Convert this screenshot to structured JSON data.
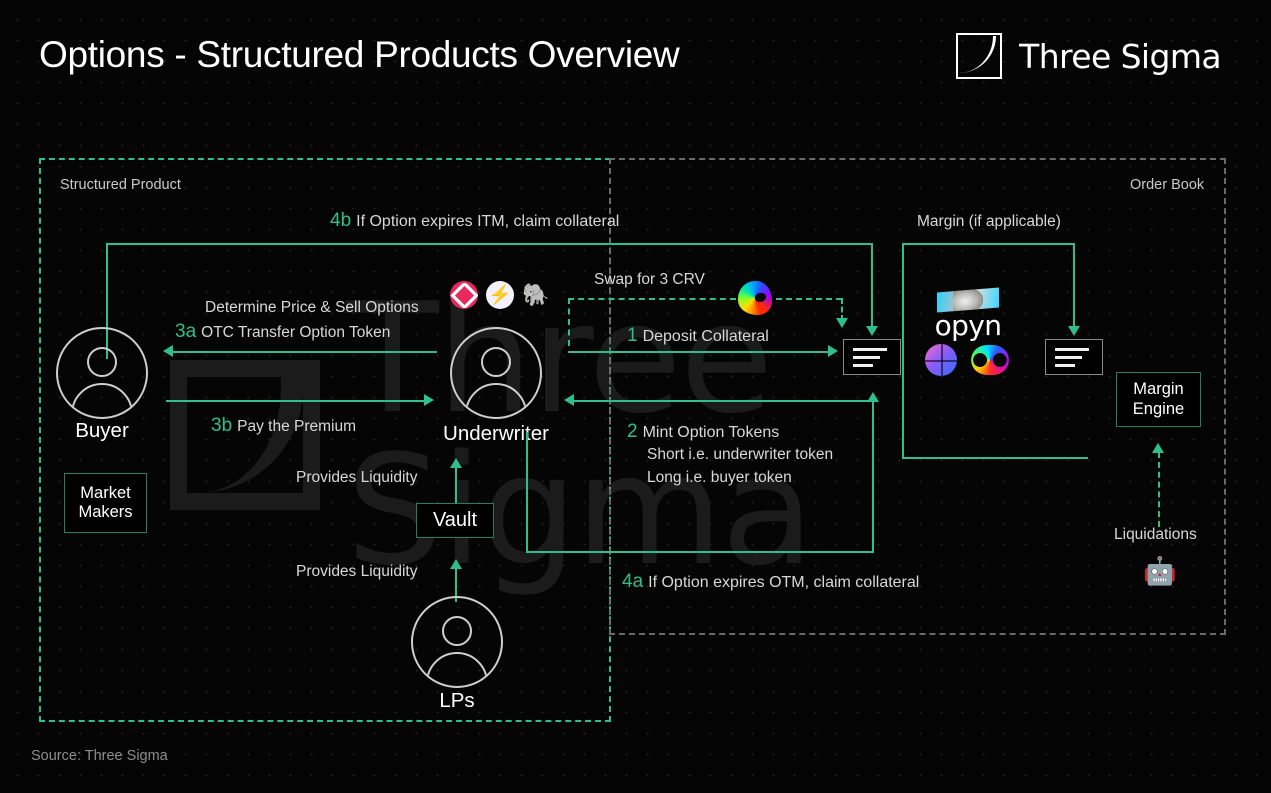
{
  "header": {
    "title": "Options - Structured Products Overview",
    "brand": "Three Sigma",
    "logo_icon": "three-sigma-mark"
  },
  "footer": {
    "source": "Source: Three Sigma"
  },
  "groups": {
    "structured_product": {
      "label": "Structured Product",
      "border_color": "#2fbf8a"
    },
    "order_book": {
      "label": "Order Book",
      "border_color": "#6a6a6a"
    }
  },
  "nodes": {
    "buyer": {
      "label": "Buyer",
      "icon": "person-icon"
    },
    "market_makers": {
      "label": "Market\nMakers",
      "line1": "Market",
      "line2": "Makers"
    },
    "underwriter": {
      "label": "Underwriter",
      "icon": "person-icon"
    },
    "vault": {
      "label": "Vault"
    },
    "lps": {
      "label": "LPs",
      "icon": "person-icon"
    },
    "margin_engine": {
      "line1": "Margin",
      "line2": "Engine"
    },
    "liquidations": {
      "label": "Liquidations",
      "icon": "robot-icon"
    },
    "opyn": {
      "label": "opyn"
    }
  },
  "protocol_icons": [
    {
      "name": "ribbon-finance-icon"
    },
    {
      "name": "thetanuts-icon"
    },
    {
      "name": "friktion-elephant-icon"
    },
    {
      "name": "curve-crv-icon"
    },
    {
      "name": "lyra-icon"
    },
    {
      "name": "premia-icon"
    }
  ],
  "flows": {
    "f4b": {
      "num": "4b",
      "text": "If Option expires ITM, claim collateral"
    },
    "f3a_l1": {
      "text": "Determine Price & Sell Options"
    },
    "f3a_l2": {
      "num": "3a",
      "text": "OTC Transfer Option Token"
    },
    "f3b": {
      "num": "3b",
      "text": "Pay the Premium"
    },
    "provides_liquidity_1": {
      "text": "Provides Liquidity"
    },
    "provides_liquidity_2": {
      "text": "Provides Liquidity"
    },
    "swap": {
      "text": "Swap for  3 CRV"
    },
    "f1": {
      "num": "1",
      "text": "Deposit Collateral"
    },
    "f2": {
      "num": "2",
      "text": "Mint Option Tokens"
    },
    "f2_l2": {
      "text": "Short i.e. underwriter token"
    },
    "f2_l3": {
      "text": "Long i.e. buyer token"
    },
    "f4a": {
      "num": "4a",
      "text": "If Option expires OTM, claim collateral"
    },
    "margin": {
      "text": "Margin (if applicable)"
    }
  },
  "colors": {
    "accent": "#2fbf8a",
    "background": "#050505",
    "text": "#e8e8e8",
    "muted": "#8d8d8d"
  }
}
